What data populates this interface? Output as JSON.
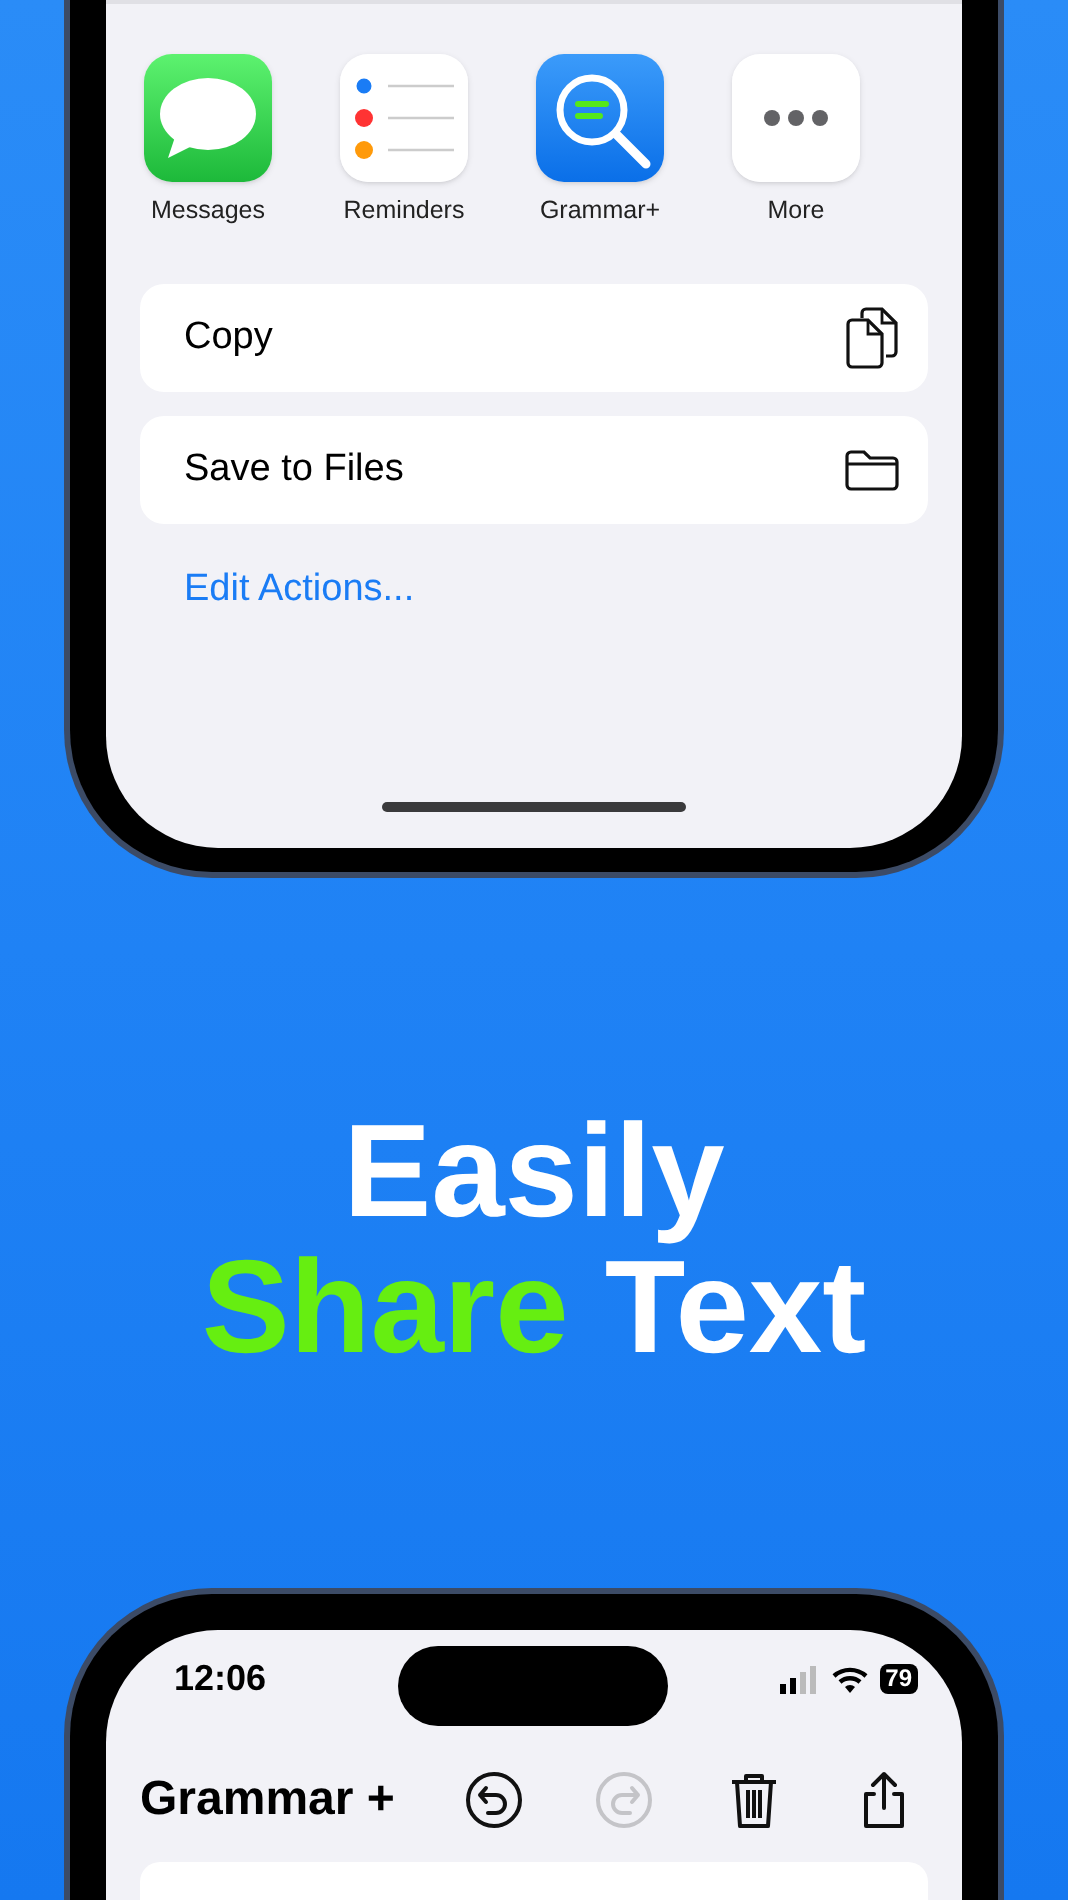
{
  "share_sheet": {
    "apps": [
      {
        "kind": "messages",
        "label": "Messages"
      },
      {
        "kind": "reminders",
        "label": "Reminders"
      },
      {
        "kind": "grammar",
        "label": "Grammar+"
      },
      {
        "kind": "more",
        "label": "More"
      }
    ],
    "actions": [
      {
        "kind": "copy",
        "label": "Copy"
      },
      {
        "kind": "files",
        "label": "Save to Files"
      }
    ],
    "edit_link": "Edit Actions..."
  },
  "headline": [
    [
      {
        "text": "Easily",
        "color": "#ffffff"
      }
    ],
    [
      {
        "text": "Share",
        "color": "#66ee11"
      },
      {
        "text": "Text",
        "color": "#ffffff"
      }
    ]
  ],
  "app_screen": {
    "time": "12:06",
    "battery": "79",
    "title": "Grammar +",
    "toolbar": [
      {
        "kind": "undo",
        "disabled": false
      },
      {
        "kind": "redo",
        "disabled": true
      },
      {
        "kind": "trash",
        "disabled": false
      },
      {
        "kind": "share",
        "disabled": false
      }
    ]
  }
}
